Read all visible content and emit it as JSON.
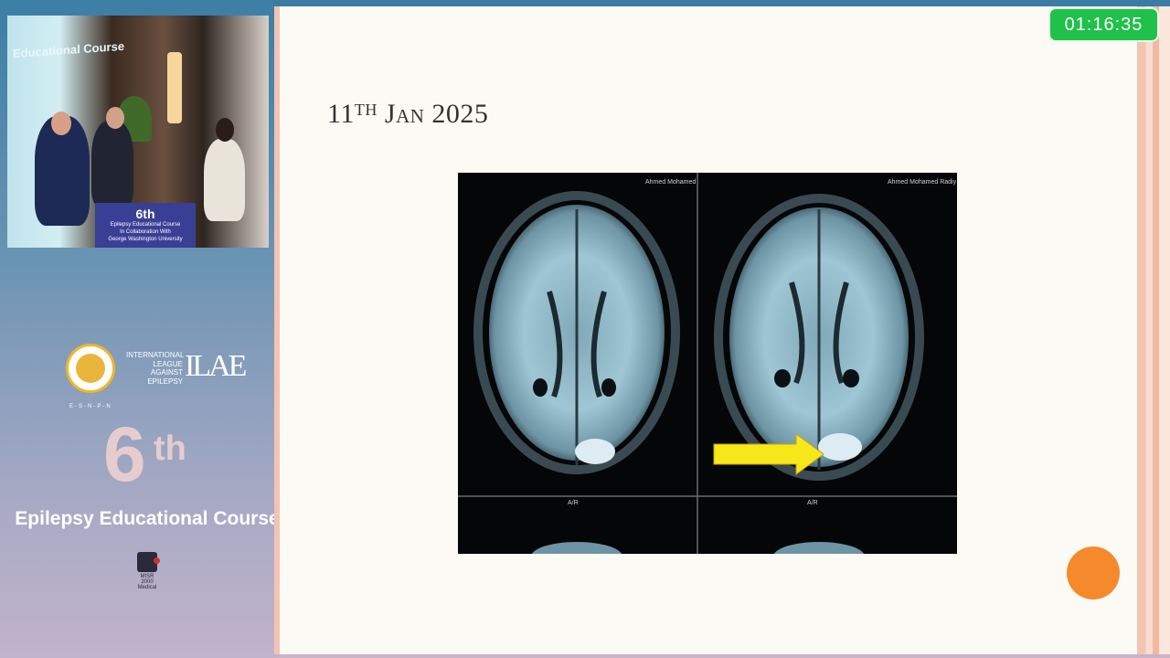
{
  "left_panel": {
    "video": {
      "banner_text": "Educational Course",
      "podium_number": "6th",
      "podium_line1": "Epilepsy Educational Course",
      "podium_line2": "In Collaboration With",
      "podium_line3": "George Washington University"
    },
    "esnpn_label": "E-S-N-P-N",
    "ilae_text": [
      "INTERNATIONAL",
      "LEAGUE",
      "AGAINST",
      "EPILEPSY"
    ],
    "ilae_mark": "ILAE",
    "course_number": "6",
    "course_suffix": "th",
    "course_title": "Epilepsy Educational Course",
    "sponsor_lines": [
      "MISR",
      "2000",
      "Medical"
    ]
  },
  "slide": {
    "title_day": "11",
    "title_suffix": "TH",
    "title_rest": "Jan 2025",
    "image_left_overlay_top": "Ahmed Mohamed",
    "image_right_overlay_top": "Ahmed Mohamed Radiy",
    "image_bottom_label": "A/R"
  },
  "timer": {
    "value": "01:16:35"
  },
  "colors": {
    "timer_bg": "#1fc14a",
    "nav_dot": "#f58a2c",
    "arrow": "#f6e81a"
  }
}
